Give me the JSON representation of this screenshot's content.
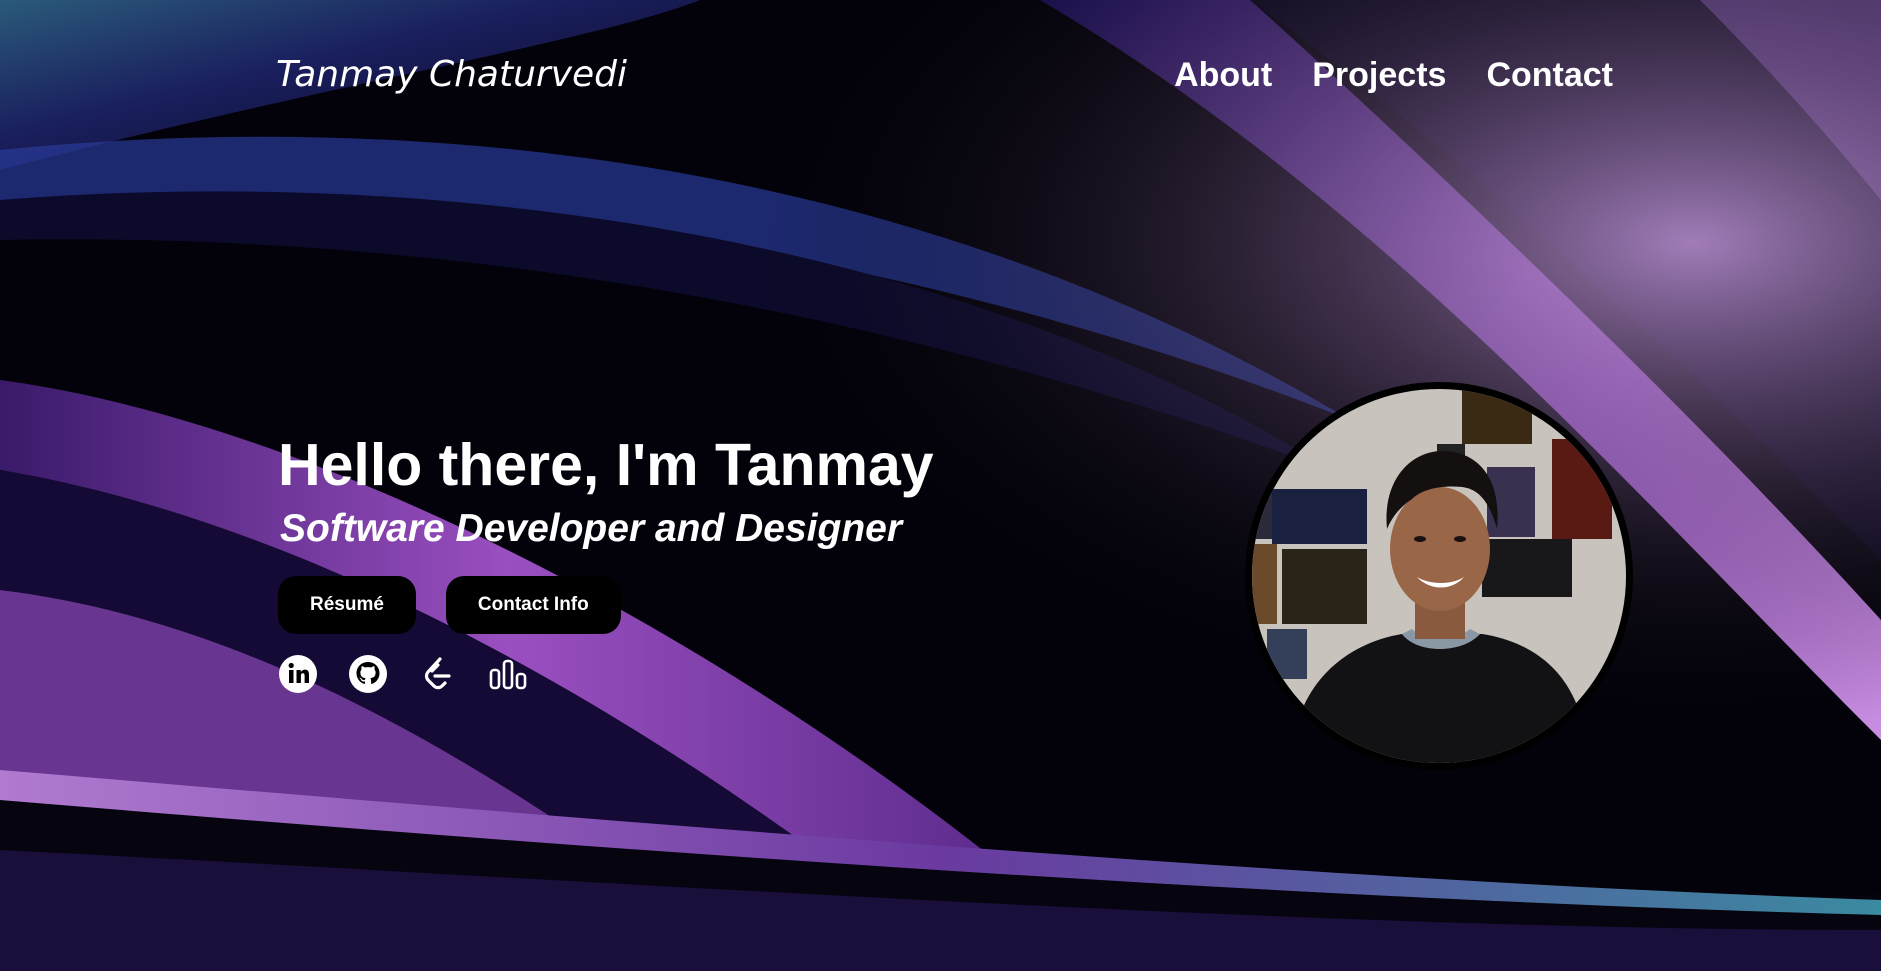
{
  "header": {
    "brand": "Tanmay Chaturvedi",
    "nav": [
      {
        "label": "About"
      },
      {
        "label": "Projects"
      },
      {
        "label": "Contact"
      }
    ]
  },
  "hero": {
    "greeting": "Hello there, I'm Tanmay",
    "subtitle": "Software Developer and Designer",
    "buttons": {
      "resume": "Résumé",
      "contact_info": "Contact Info"
    },
    "socials": [
      {
        "icon": "linkedin-icon"
      },
      {
        "icon": "github-icon"
      },
      {
        "icon": "leetcode-icon"
      },
      {
        "icon": "stats-icon"
      }
    ]
  },
  "colors": {
    "text": "#ffffff",
    "button_bg": "#000000",
    "accent_purple": "#9b5fc8",
    "accent_blue": "#1c2a7a"
  }
}
